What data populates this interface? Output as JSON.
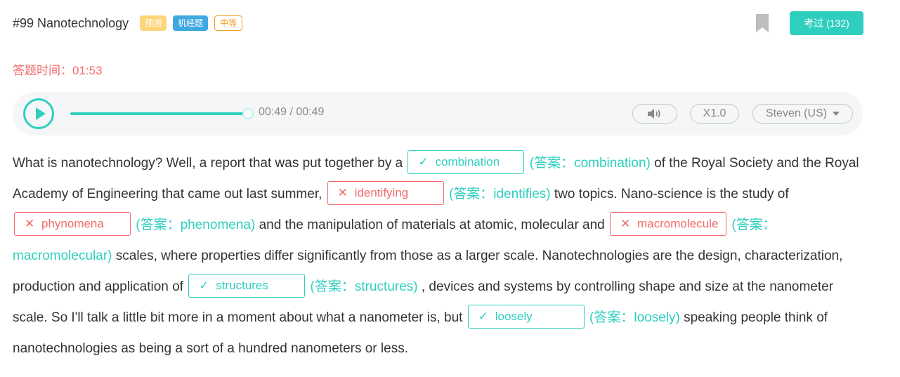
{
  "header": {
    "title": "#99 Nanotechnology",
    "tags": [
      "预测",
      "机经题",
      "中等"
    ],
    "exam_button": "考过 (132)"
  },
  "timer": {
    "label": "答题时间：",
    "value": "01:53"
  },
  "player": {
    "time": "00:49 / 00:49",
    "progress": 1.0,
    "speed": "X1.0",
    "voice": "Steven (US)"
  },
  "passage": {
    "t1": "What is nanotechnology? Well, a report that was put together by a ",
    "t2": " of the Royal Society and the Royal Academy of Engineering that came out last summer, ",
    "t3": " two topics. Nano-science is the study of ",
    "t4": " and the manipulation of materials at atomic, molecular and ",
    "t5": " scales, where properties differ significantly from those as a larger scale. Nanotechnologies are the design, characterization, production and application of ",
    "t6": " , devices and systems by controlling shape and size at the nanometer scale. So I'll talk a little bit more in a moment about what a nanometer is, but ",
    "t7": " speaking people think of nanotechnologies as being a sort of a hundred nanometers or less."
  },
  "blanks": [
    {
      "mark": "✓",
      "value": "combination",
      "answer": "(答案：combination)",
      "correct": true
    },
    {
      "mark": "✕",
      "value": "identifying",
      "answer": "(答案：identifies)",
      "correct": false
    },
    {
      "mark": "✕",
      "value": "phynomena",
      "answer": "(答案：phenomena)",
      "correct": false
    },
    {
      "mark": "✕",
      "value": "macromolecule",
      "answer": "(答案：macromolecular)",
      "correct": false
    },
    {
      "mark": "✓",
      "value": "structures",
      "answer": "(答案：structures)",
      "correct": true
    },
    {
      "mark": "✓",
      "value": "loosely",
      "answer": "(答案：loosely)",
      "correct": true
    }
  ],
  "colors": {
    "accent": "#2fcfbf",
    "error": "#f26b6b",
    "tag_predict": "#ffd57a",
    "tag_memory": "#3fa8e0",
    "tag_level": "#f0a020"
  },
  "icons": [
    "play-icon",
    "bookmark-icon",
    "volume-icon",
    "caret-down-icon",
    "check-icon",
    "cross-icon"
  ]
}
